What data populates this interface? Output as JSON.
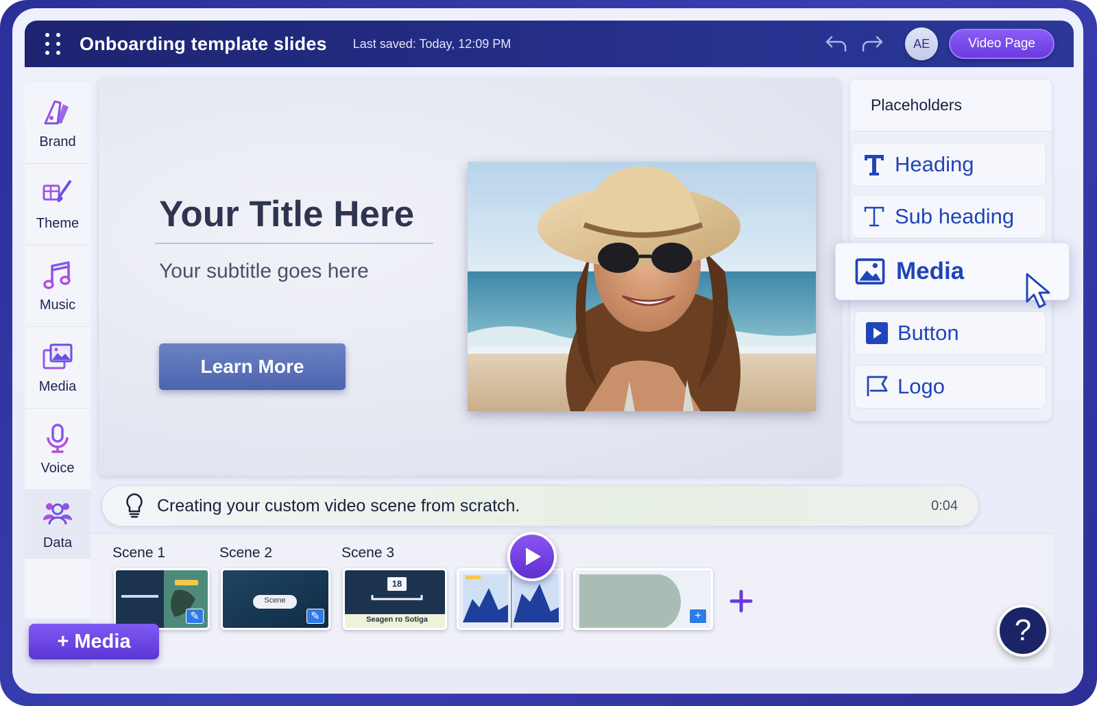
{
  "header": {
    "title": "Onboarding template slides",
    "last_saved": "Last saved: Today, 12:09 PM",
    "avatar_initials": "AE",
    "video_page_label": "Video Page"
  },
  "sidebar": {
    "items": [
      {
        "label": "Brand",
        "icon": "palette-icon"
      },
      {
        "label": "Theme",
        "icon": "paintbrush-icon"
      },
      {
        "label": "Music",
        "icon": "music-note-icon"
      },
      {
        "label": "Media",
        "icon": "image-gallery-icon"
      },
      {
        "label": "Voice",
        "icon": "microphone-icon"
      },
      {
        "label": "Data",
        "icon": "people-icon"
      }
    ]
  },
  "slide": {
    "title": "Your Title Here",
    "subtitle": "Your subtitle goes here",
    "button_label": "Learn More"
  },
  "placeholders": {
    "header": "Placeholders",
    "items": [
      {
        "label": "Heading",
        "icon": "bold-t-icon"
      },
      {
        "label": "Sub heading",
        "icon": "serif-t-icon"
      },
      {
        "label": "Media",
        "icon": "image-icon",
        "selected": true
      },
      {
        "label": "Button",
        "icon": "play-square-icon"
      },
      {
        "label": "Logo",
        "icon": "flag-icon"
      }
    ]
  },
  "status": {
    "message": "Creating your custom video scene from scratch.",
    "time": "0:04"
  },
  "timeline": {
    "scenes": [
      "Scene 1",
      "Scene 2",
      "Scene 3"
    ],
    "thumb2_text": "Scene",
    "thumb3_number": "18",
    "thumb3_caption": "Seagen ro Sotiga"
  },
  "actions": {
    "add_media_label": "+ Media",
    "help_label": "?"
  },
  "colors": {
    "accent_purple": "#6a3ae0",
    "header_navy": "#1d2470",
    "link_blue": "#1f45b8"
  }
}
